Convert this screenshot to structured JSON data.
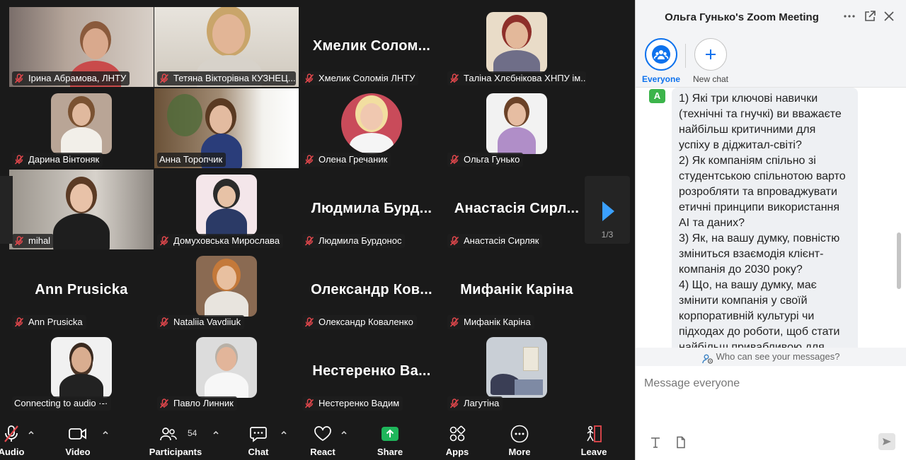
{
  "gallery": {
    "tiles": [
      {
        "name": "Ірина Абрамова, ЛНТУ",
        "kind": "video"
      },
      {
        "name": "Тетяна Вікторівна КУЗНЕЦ...",
        "kind": "video"
      },
      {
        "name": "Хмелик Соломія ЛНТУ",
        "big_name": "Хмелик  Солом...",
        "kind": "name"
      },
      {
        "name": "Таліна Хлєбнікова ХНПУ ім...",
        "kind": "photo"
      },
      {
        "name": "Дарина Вінтоняк",
        "kind": "photo"
      },
      {
        "name": "Анна Торопчик",
        "kind": "video",
        "active": true
      },
      {
        "name": "Олена Гречаник",
        "kind": "photo"
      },
      {
        "name": "Ольга Гунько",
        "kind": "photo"
      },
      {
        "name": "mihal",
        "kind": "video"
      },
      {
        "name": "Домуховська Мирослава",
        "kind": "photo"
      },
      {
        "name": "Людмила Бурдонос",
        "big_name": "Людмила  Бурд...",
        "kind": "name"
      },
      {
        "name": "Анастасія Сирляк",
        "big_name": "Анастасія  Сирл...",
        "kind": "name"
      },
      {
        "name": "Ann Prusicka",
        "big_name": "Ann Prusicka",
        "kind": "name"
      },
      {
        "name": "Nataliia Vavdiiuk",
        "kind": "photo"
      },
      {
        "name": "Олександр Коваленко",
        "big_name": "Олександр  Ков...",
        "kind": "name"
      },
      {
        "name": "Мифанік Каріна",
        "big_name": "Мифанік Каріна",
        "kind": "name"
      },
      {
        "name": "Connecting to audio ·-·",
        "kind": "photo"
      },
      {
        "name": "Павло Линник",
        "kind": "photo"
      },
      {
        "name": "Нестеренко Вадим",
        "big_name": "Нестеренко  Ва...",
        "kind": "name"
      },
      {
        "name": "Лагутіна",
        "kind": "photo"
      }
    ],
    "page_indicator": "1/3"
  },
  "toolbar": {
    "audio": "Audio",
    "video": "Video",
    "participants": "Participants",
    "participants_count": "54",
    "chat": "Chat",
    "react": "React",
    "share": "Share",
    "apps": "Apps",
    "more": "More",
    "leave": "Leave"
  },
  "chat": {
    "title": "Ольга Гунько's Zoom Meeting",
    "targets": {
      "everyone": "Everyone",
      "new_chat": "New chat"
    },
    "sender_initial": "A",
    "message": "1) Які три ключові навички\n(технічні та гнучкі) ви вважаєте\nнайбільш критичними для\nуспіху в діджитал-світі?\n2) Як компаніям спільно зі\nстудентською спільнотою варто\nрозробляти та впроваджувати\nетичні принципи використання\nAI та даних?\n3) Як, на вашу думку, повністю\nзміниться взаємодія клієнт-\nкомпанія до 2030 року?\n4) Що, на вашу думку, має\nзмінити компанія у своїй\nкорпоративній культурі чи\nпідходах до роботи, щоб стати\nнайбільш привабливою для",
    "visibility": "Who can see your messages?",
    "input_placeholder": "Message everyone"
  },
  "colors": {
    "accent": "#0e72ed",
    "active_speaker": "#6fde56",
    "share": "#1fb65b",
    "leave": "#e5484d"
  }
}
